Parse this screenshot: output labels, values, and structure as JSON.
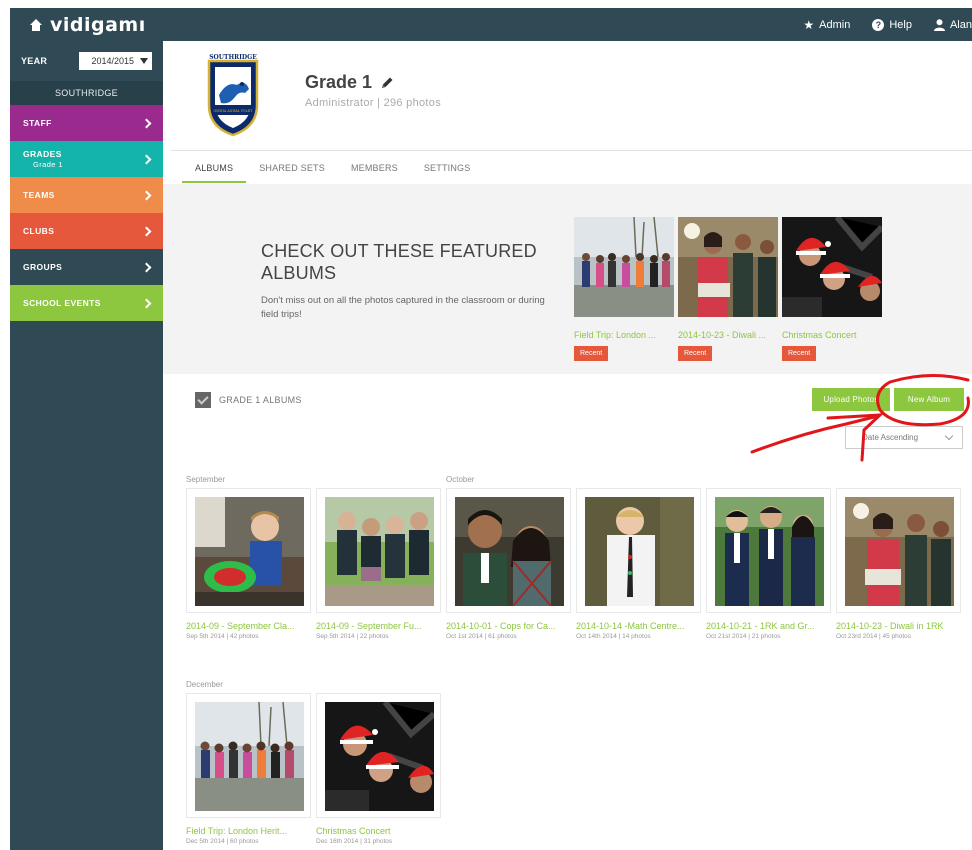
{
  "topbar": {
    "brand": "vidigamı",
    "nav": [
      {
        "label": "Admin",
        "icon": "star-icon"
      },
      {
        "label": "Help",
        "icon": "help-icon"
      },
      {
        "label": "Alan",
        "icon": "user-icon"
      }
    ]
  },
  "sidebar": {
    "year_label": "YEAR",
    "year_value": "2014/2015",
    "school": "SOUTHRIDGE",
    "items": [
      {
        "label": "STAFF",
        "sub": "",
        "color": "#9b2a8e"
      },
      {
        "label": "GRADES",
        "sub": "Grade 1",
        "color": "#14b4aa"
      },
      {
        "label": "TEAMS",
        "sub": "",
        "color": "#ef8c4a"
      },
      {
        "label": "CLUBS",
        "sub": "",
        "color": "#e5583b"
      },
      {
        "label": "GROUPS",
        "sub": "",
        "color": "#2f4a55"
      },
      {
        "label": "SCHOOL EVENTS",
        "sub": "",
        "color": "#8dc63f"
      }
    ]
  },
  "header": {
    "crest_text": "SOUTHRIDGE",
    "crest_motto": "OMNIA ANIMA VOLET",
    "title": "Grade 1",
    "subtitle": "Administrator | 296 photos"
  },
  "tabs": [
    "ALBUMS",
    "SHARED SETS",
    "MEMBERS",
    "SETTINGS"
  ],
  "featured": {
    "title": "CHECK OUT THESE FEATURED ALBUMS",
    "description": "Don't miss out on all the photos captured in the classroom or during field trips!",
    "cards": [
      {
        "caption": "Field Trip: London ...",
        "badge": "Recent"
      },
      {
        "caption": "2014-10-23 - Diwali ...",
        "badge": "Recent"
      },
      {
        "caption": "Christmas Concert",
        "badge": "Recent"
      }
    ]
  },
  "albums_section": {
    "heading": "GRADE 1 ALBUMS",
    "upload_label": "Upload Photos",
    "new_album_label": "New Album",
    "sort_value": "Date Ascending"
  },
  "months": [
    "September",
    "October",
    "December"
  ],
  "albums": [
    {
      "name": "2014-09 - September Cla...",
      "meta": "Sep 5th 2014 | 42 photos"
    },
    {
      "name": "2014-09 - September Fu...",
      "meta": "Sep 5th 2014 | 22 photos"
    },
    {
      "name": "2014-10-01 - Cops for Ca...",
      "meta": "Oct 1st 2014 | 61 photos"
    },
    {
      "name": "2014-10-14 -Math Centre...",
      "meta": "Oct 14th 2014 | 14 photos"
    },
    {
      "name": "2014-10-21 - 1RK and Gr...",
      "meta": "Oct 21st 2014 | 21 photos"
    },
    {
      "name": "2014-10-23 - Diwali in 1RK",
      "meta": "Oct 23rd 2014 | 45 photos"
    },
    {
      "name": "Field Trip: London Herit...",
      "meta": "Dec 5th 2014 | 60 photos"
    },
    {
      "name": "Christmas Concert",
      "meta": "Dec 16th 2014 | 31 photos"
    }
  ],
  "colors": {
    "accent_green": "#8dc63f",
    "recent_badge": "#e5583b",
    "topbar": "#2f4a55",
    "annotation_red": "#e0161b"
  }
}
